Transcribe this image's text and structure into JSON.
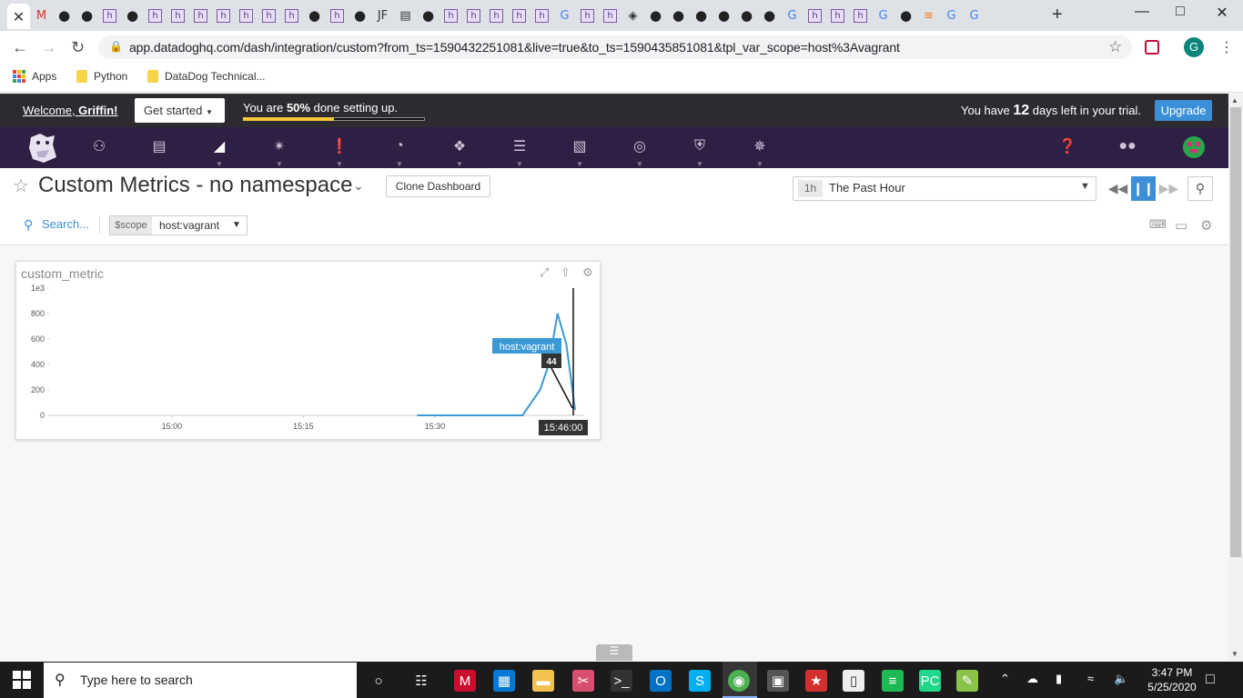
{
  "browser": {
    "url": "app.datadoghq.com/dash/integration/custom?from_ts=1590432251081&live=true&to_ts=1590435851081&tpl_var_scope=host%3Avagrant",
    "profile_initial": "G",
    "bookmarks": [
      {
        "label": "Apps",
        "icon": "apps-grid-icon"
      },
      {
        "label": "Python",
        "icon": "folder-icon"
      },
      {
        "label": "DataDog Technical...",
        "icon": "folder-icon"
      }
    ],
    "tab_icon_names": [
      "close-icon",
      "gmail-icon",
      "github-icon",
      "github-icon",
      "heroku-icon",
      "github-icon",
      "heroku-icon",
      "heroku-icon",
      "heroku-icon",
      "heroku-icon",
      "heroku-icon",
      "heroku-icon",
      "heroku-icon",
      "github-icon",
      "heroku-icon",
      "github-icon",
      "jf-icon",
      "reader-icon",
      "github-icon",
      "heroku-icon",
      "heroku-icon",
      "heroku-icon",
      "heroku-icon",
      "heroku-icon",
      "google-icon",
      "heroku-icon",
      "heroku-icon",
      "diamond-icon",
      "github-icon",
      "github-icon",
      "github-icon",
      "github-icon",
      "github-icon",
      "github-icon",
      "google-icon",
      "heroku-icon",
      "heroku-icon",
      "heroku-icon",
      "google-icon",
      "github-icon",
      "stackoverflow-icon",
      "google-icon",
      "google-icon"
    ]
  },
  "banner": {
    "welcome_prefix": "Welcome, ",
    "welcome_name": "Griffin!",
    "get_started": "Get started",
    "progress_prefix": "You are ",
    "progress_percent": "50%",
    "progress_suffix": " done setting up.",
    "progress_fraction": 0.5,
    "trial_prefix": "You have ",
    "trial_days": "12",
    "trial_suffix": " days left in your trial.",
    "upgrade": "Upgrade"
  },
  "nav": {
    "items": [
      "binoculars-icon",
      "list-icon",
      "dashboard-chart-icon",
      "infrastructure-icon",
      "monitors-alert-icon",
      "apm-gauge-icon",
      "integrations-puzzle-icon",
      "logs-icon",
      "notebook-icon",
      "synthetics-icon",
      "security-shield-icon",
      "watchdog-icon"
    ],
    "right": [
      "help-icon",
      "team-icon",
      "user-avatar"
    ]
  },
  "dashboard": {
    "title": "Custom Metrics - no namespace",
    "clone_label": "Clone Dashboard",
    "time_badge": "1h",
    "time_label": "The Past Hour",
    "search_label": "Search...",
    "scope_name": "$scope",
    "scope_value": "host:vagrant"
  },
  "widget": {
    "title": "custom_metric",
    "tooltip_host": "host:vagrant",
    "tooltip_value": "44",
    "cursor_time": "15:46:00"
  },
  "chart_data": {
    "type": "line",
    "title": "custom_metric",
    "ylim": [
      0,
      1000
    ],
    "y_ticks": [
      "1e3",
      "800",
      "600",
      "400",
      "200",
      "0"
    ],
    "x_ticks": [
      "15:00",
      "15:15",
      "15:30"
    ],
    "xlim": [
      "14:46",
      "15:46"
    ],
    "series": [
      {
        "name": "host:vagrant",
        "color": "#3c99d4",
        "x": [
          "15:28",
          "15:30",
          "15:35",
          "15:39",
          "15:40",
          "15:42",
          "15:43",
          "15:44",
          "15:45",
          "15:46"
        ],
        "y": [
          0,
          0,
          0,
          0,
          0,
          200,
          400,
          800,
          560,
          44
        ]
      }
    ],
    "grid": false,
    "legend": "tooltip"
  },
  "taskbar": {
    "search_placeholder": "Type here to search",
    "time": "3:47 PM",
    "date": "5/25/2020"
  }
}
